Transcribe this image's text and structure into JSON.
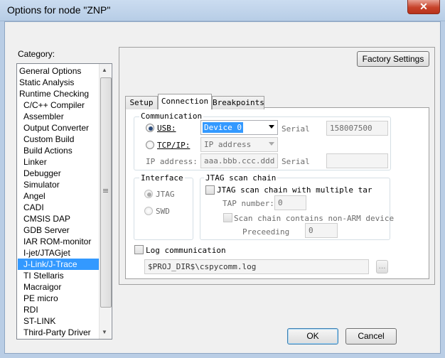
{
  "window": {
    "title": "Options for node \"ZNP\"",
    "close_glyph": "✕"
  },
  "category": {
    "label": "Category:",
    "items": [
      {
        "label": "General Options",
        "indent": false
      },
      {
        "label": "Static Analysis",
        "indent": false
      },
      {
        "label": "Runtime Checking",
        "indent": false
      },
      {
        "label": "C/C++ Compiler",
        "indent": true
      },
      {
        "label": "Assembler",
        "indent": true
      },
      {
        "label": "Output Converter",
        "indent": true
      },
      {
        "label": "Custom Build",
        "indent": true
      },
      {
        "label": "Build Actions",
        "indent": true
      },
      {
        "label": "Linker",
        "indent": true
      },
      {
        "label": "Debugger",
        "indent": true
      },
      {
        "label": "Simulator",
        "indent": true
      },
      {
        "label": "Angel",
        "indent": true
      },
      {
        "label": "CADI",
        "indent": true
      },
      {
        "label": "CMSIS DAP",
        "indent": true
      },
      {
        "label": "GDB Server",
        "indent": true
      },
      {
        "label": "IAR ROM-monitor",
        "indent": true
      },
      {
        "label": "I-jet/JTAGjet",
        "indent": true
      },
      {
        "label": "J-Link/J-Trace",
        "indent": true,
        "selected": true
      },
      {
        "label": "TI Stellaris",
        "indent": true
      },
      {
        "label": "Macraigor",
        "indent": true
      },
      {
        "label": "PE micro",
        "indent": true
      },
      {
        "label": "RDI",
        "indent": true
      },
      {
        "label": "ST-LINK",
        "indent": true
      },
      {
        "label": "Third-Party Driver",
        "indent": true
      }
    ]
  },
  "factory_settings": "Factory Settings",
  "tabs": [
    {
      "label": "Setup",
      "active": false
    },
    {
      "label": "Connection",
      "active": true
    },
    {
      "label": "Breakpoints",
      "active": false
    }
  ],
  "communication": {
    "label": "Communication",
    "usb_label": "USB:",
    "usb_device": "Device 0",
    "serial_label": "Serial",
    "serial_value": "158007500",
    "tcpip_label": "TCP/IP:",
    "tcpip_mode": "IP address",
    "ip_label": "IP address:",
    "ip_value": "aaa.bbb.ccc.ddd",
    "serial2_label": "Serial",
    "serial2_value": ""
  },
  "interface": {
    "label": "Interface",
    "jtag": "JTAG",
    "swd": "SWD"
  },
  "jtag_chain": {
    "label": "JTAG scan chain",
    "multiple_label": "JTAG scan chain with multiple tar",
    "tap_label": "TAP number:",
    "tap_value": "0",
    "non_arm_label": "Scan chain contains non-ARM device",
    "preceeding_label": "Preceeding",
    "preceeding_value": "0"
  },
  "log": {
    "label": "Log communication",
    "path": "$PROJ_DIR$\\cspycomm.log",
    "browse": "..."
  },
  "buttons": {
    "ok": "OK",
    "cancel": "Cancel"
  }
}
